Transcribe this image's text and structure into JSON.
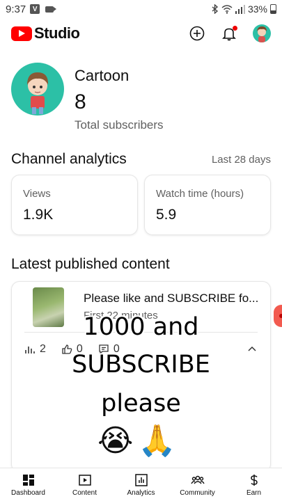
{
  "status_bar": {
    "time": "9:37",
    "badge": "V",
    "battery": "33%"
  },
  "app": {
    "name": "Studio"
  },
  "channel": {
    "name": "Cartoon",
    "subscribers": "8",
    "subscribers_label": "Total subscribers"
  },
  "analytics": {
    "title": "Channel analytics",
    "period": "Last 28 days",
    "cards": [
      {
        "label": "Views",
        "value": "1.9K"
      },
      {
        "label": "Watch time (hours)",
        "value": "5.9"
      }
    ]
  },
  "latest": {
    "title": "Latest published content",
    "video_title": "Please like and SUBSCRIBE fo...",
    "video_sub": "First 22 minutes",
    "stats": {
      "views": "2",
      "likes": "0",
      "comments": "0"
    }
  },
  "overlay": {
    "line1": "1000 and",
    "line2": "SUBSCRIBE",
    "line3": "please",
    "emoji1": "😭",
    "emoji2": "🙏"
  },
  "nav": [
    {
      "label": "Dashboard",
      "icon": "dashboard-icon"
    },
    {
      "label": "Content",
      "icon": "content-icon"
    },
    {
      "label": "Analytics",
      "icon": "analytics-icon"
    },
    {
      "label": "Community",
      "icon": "community-icon"
    },
    {
      "label": "Earn",
      "icon": "dollar-icon"
    }
  ],
  "colors": {
    "brand": "#ff0000",
    "avatar_bg": "#2cc0a6",
    "notification": "#ee0000"
  }
}
